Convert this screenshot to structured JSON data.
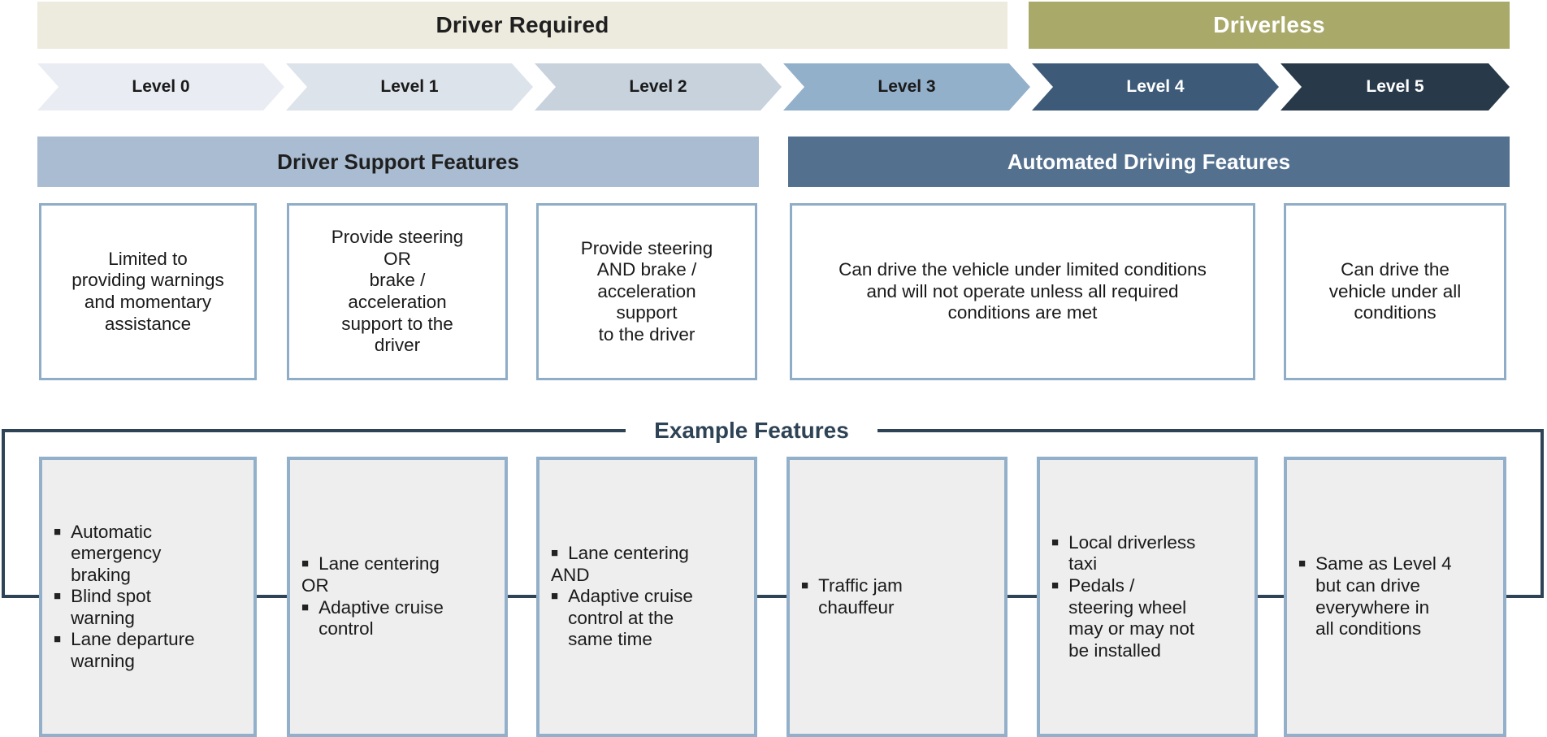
{
  "banners": [
    {
      "label": "Driver Required",
      "color": "#edeade",
      "text_color": "#1f1f1f"
    },
    {
      "label": "Driverless",
      "color": "#a9a96a",
      "text_color": "#ffffff"
    }
  ],
  "levels": [
    {
      "label": "Level 0",
      "fill": "#e9edf3",
      "text_color": "#1a1a1a"
    },
    {
      "label": "Level 1",
      "fill": "#dde3ea",
      "text_color": "#1a1a1a"
    },
    {
      "label": "Level 2",
      "fill": "#c7d2dd",
      "text_color": "#1a1a1a"
    },
    {
      "label": "Level 3",
      "fill": "#93b0cb",
      "text_color": "#1a1a1a"
    },
    {
      "label": "Level 4",
      "fill": "#3d5b78",
      "text_color": "#ffffff"
    },
    {
      "label": "Level 5",
      "fill": "#28394a",
      "text_color": "#ffffff"
    }
  ],
  "groups": [
    {
      "label": "Driver Support Features",
      "color": "#a9bcd2",
      "text_color": "#1f1f1f"
    },
    {
      "label": "Automated Driving Features",
      "color": "#53708f",
      "text_color": "#ffffff"
    }
  ],
  "descriptions": [
    "Limited to\nproviding warnings\nand momentary\nassistance",
    "Provide steering\nOR\nbrake /\nacceleration\nsupport to the\ndriver",
    "Provide steering\nAND brake /\nacceleration\nsupport\nto the driver",
    "Can drive the vehicle under limited conditions\nand will not operate unless all required\nconditions are met",
    "Can drive the\nvehicle under all\nconditions"
  ],
  "example_features": {
    "title": "Example Features",
    "bullet_glyph": "■",
    "cards": [
      {
        "items": [
          {
            "bullet": true,
            "text": "Automatic\nemergency\nbraking"
          },
          {
            "bullet": true,
            "text": "Blind spot\nwarning"
          },
          {
            "bullet": true,
            "text": "Lane departure\nwarning"
          }
        ]
      },
      {
        "items": [
          {
            "bullet": true,
            "text": "Lane centering"
          },
          {
            "bullet": false,
            "text": "OR"
          },
          {
            "bullet": true,
            "text": "Adaptive cruise\ncontrol"
          }
        ]
      },
      {
        "items": [
          {
            "bullet": true,
            "text": "Lane centering"
          },
          {
            "bullet": false,
            "text": "AND"
          },
          {
            "bullet": true,
            "text": "Adaptive cruise\ncontrol at the\nsame time"
          }
        ]
      },
      {
        "items": [
          {
            "bullet": true,
            "text": "Traffic jam\nchauffeur"
          }
        ]
      },
      {
        "items": [
          {
            "bullet": true,
            "text": "Local driverless\ntaxi"
          },
          {
            "bullet": true,
            "text": "Pedals /\nsteering wheel\nmay or may not\nbe installed"
          }
        ]
      },
      {
        "items": [
          {
            "bullet": true,
            "text": "Same as Level 4\nbut can drive\neverywhere in\nall conditions"
          }
        ]
      }
    ]
  },
  "colors": {
    "card_border": "#8fadc7",
    "example_card_border": "#93b0cb",
    "example_card_fill": "#eeeeef",
    "bracket": "#2e4356"
  }
}
